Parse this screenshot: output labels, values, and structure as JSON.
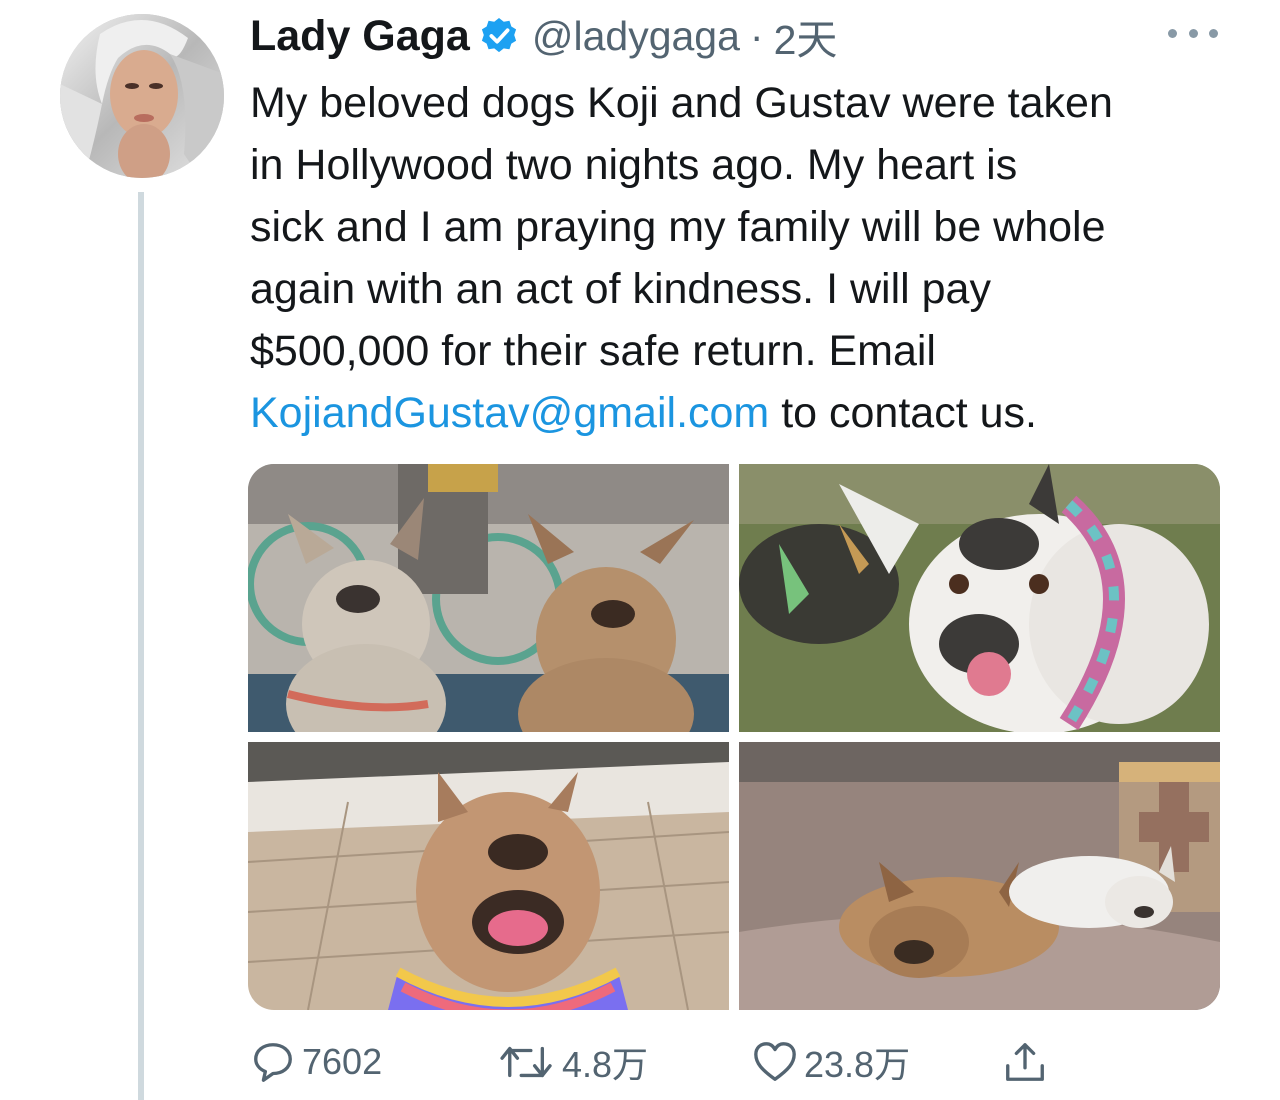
{
  "tweet": {
    "author_name": "Lady Gaga",
    "handle": "@ladygaga",
    "separator": "·",
    "timestamp": "2天",
    "text_lines": [
      "My beloved dogs Koji and Gustav were taken",
      "in Hollywood two nights ago. My heart is",
      "sick and I am praying my family will be whole",
      "again with an act of kindness. I will pay",
      "$500,000 for their safe return. Email"
    ],
    "email_link": "KojiandGustav@gmail.com",
    "text_tail": " to contact us.",
    "verified_color": "#1da1f2",
    "link_color": "#1b95e0"
  },
  "actions": {
    "reply_count": "7602",
    "retweet_count": "4.8万",
    "like_count": "23.8万"
  },
  "icons": {
    "reply": "comment-bubble-icon",
    "retweet": "retweet-arrows-icon",
    "like": "heart-icon",
    "share": "share-upload-icon",
    "more": "more-dots-icon",
    "verified": "verified-badge-icon"
  }
}
